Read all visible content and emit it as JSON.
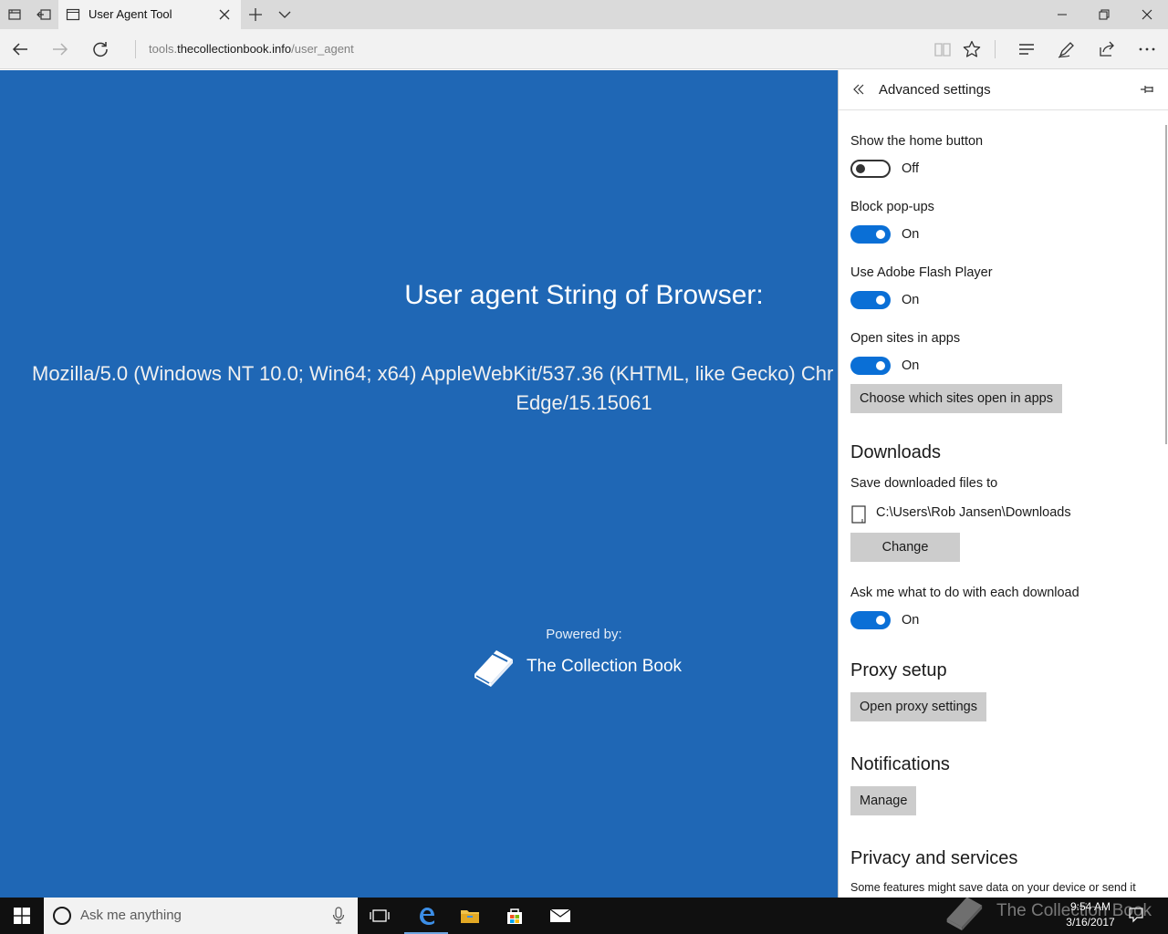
{
  "browser": {
    "tab_title": "User Agent Tool",
    "url_prefix": "tools.",
    "url_host": "thecollectionbook.info",
    "url_path": "/user_agent"
  },
  "page": {
    "heading": "User agent String of Browser:",
    "ua_line1": "Mozilla/5.0 (Windows NT 10.0; Win64; x64) AppleWebKit/537.36 (KHTML, like Gecko) Chr",
    "ua_line2": "Edge/15.15061",
    "powered_by": "Powered by:",
    "brand": "The Collection Book",
    "background_color": "#1f67b5"
  },
  "settings": {
    "title": "Advanced settings",
    "home_button": {
      "label": "Show the home button",
      "state": "Off"
    },
    "popups": {
      "label": "Block pop-ups",
      "state": "On"
    },
    "flash": {
      "label": "Use Adobe Flash Player",
      "state": "On"
    },
    "open_in_apps": {
      "label": "Open sites in apps",
      "state": "On",
      "button": "Choose which sites open in apps"
    },
    "downloads": {
      "heading": "Downloads",
      "save_label": "Save downloaded files to",
      "path": "C:\\Users\\Rob Jansen\\Downloads",
      "change_button": "Change",
      "ask_label": "Ask me what to do with each download",
      "ask_state": "On"
    },
    "proxy": {
      "heading": "Proxy setup",
      "button": "Open proxy settings"
    },
    "notifications": {
      "heading": "Notifications",
      "button": "Manage"
    },
    "privacy": {
      "heading": "Privacy and services",
      "desc": "Some features might save data on your device or send it"
    },
    "accent_color": "#0a6fd6"
  },
  "taskbar": {
    "search_placeholder": "Ask me anything",
    "time": "9:54 AM",
    "date": "3/16/2017",
    "watermark": "The Collection Book"
  },
  "icons": [
    "tab-manager-icon",
    "set-aside-tabs-icon",
    "page-icon",
    "close-tab-icon",
    "new-tab-icon",
    "tab-preview-icon",
    "minimize-icon",
    "restore-icon",
    "close-window-icon",
    "back-icon",
    "forward-icon",
    "refresh-icon",
    "reading-view-icon",
    "favorite-star-icon",
    "hub-icon",
    "web-note-icon",
    "share-icon",
    "more-icon",
    "collapse-icon",
    "pin-icon",
    "device-icon",
    "windows-start-icon",
    "cortana-icon",
    "mic-icon",
    "task-view-icon",
    "edge-icon",
    "file-explorer-icon",
    "store-icon",
    "mail-icon",
    "book-logo-icon"
  ]
}
